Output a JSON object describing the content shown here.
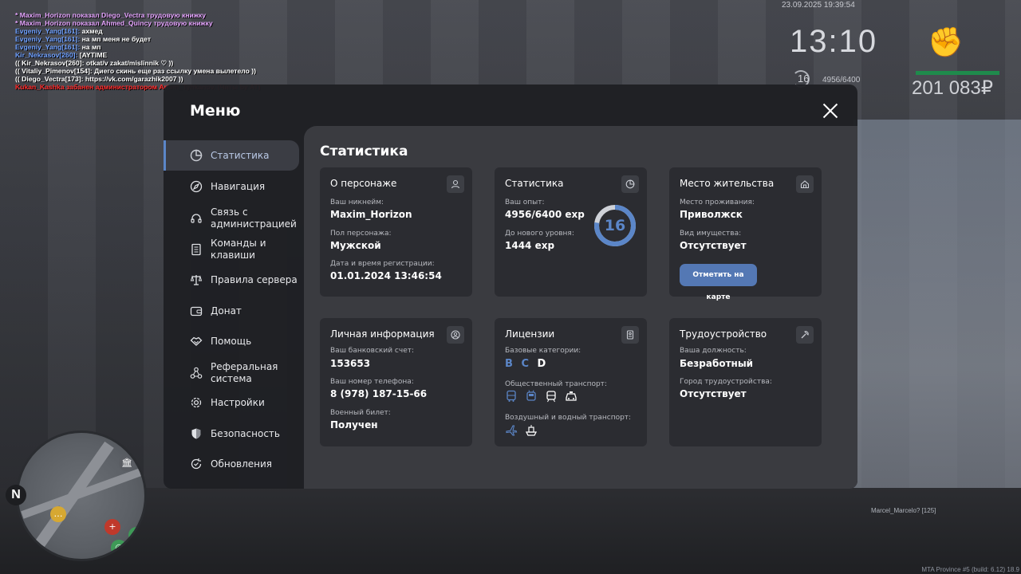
{
  "chat": [
    {
      "color": "pink",
      "text": "* Maxim_Horizon показал Diego_Vectra трудовую книжку"
    },
    {
      "color": "pink",
      "text": "* Maxim_Horizon показал Ahmed_Quincy трудовую книжку"
    },
    {
      "color": "blue",
      "text": "Evgeniy_Yang[161]:",
      "rest": " ахмед"
    },
    {
      "color": "blue",
      "text": "Evgeniy_Yang[161]:",
      "rest": " на мп меня не будет"
    },
    {
      "color": "blue",
      "text": "Evgeniy_Yang[161]:",
      "rest": " на мп"
    },
    {
      "color": "blue",
      "text": "Kir_Nekrasov[260]:",
      "rest": " [AYTIME"
    },
    {
      "color": "white",
      "text": "(( Kir_Nekrasov[260]: otkat/v zakat/mislinnik ♡ ))"
    },
    {
      "color": "white",
      "text": "(( Vitaliy_Pimenov[154]: Диего скинь еще раз ссылку умена вылетело ))"
    },
    {
      "color": "white",
      "text": "(( Diego_Vectra[173]: https://vk.com/garazhik2007 ))"
    },
    {
      "color": "red",
      "text": "Kukan_Kashka забанен администратором Artem_Tyhkanov. (Читы by AT)"
    }
  ],
  "hud": {
    "datetime": "23.09.2025 19:39:54",
    "clock": "13:10",
    "level": "16",
    "exp": "4956/6400",
    "money": "201 083₽",
    "compass": "N",
    "player_tag": "Marcel_Marcelo? [125]",
    "build": "MTA Province #5 (build: 6.12) 18.9"
  },
  "menu": {
    "title": "Меню",
    "sidebar": [
      {
        "label": "Статистика",
        "icon": "pie-chart-icon",
        "active": true
      },
      {
        "label": "Навигация",
        "icon": "compass-icon"
      },
      {
        "label": "Связь с администрацией",
        "icon": "headset-icon"
      },
      {
        "label": "Команды и клавиши",
        "icon": "document-icon"
      },
      {
        "label": "Правила сервера",
        "icon": "scales-icon"
      },
      {
        "label": "Донат",
        "icon": "wallet-icon"
      },
      {
        "label": "Помощь",
        "icon": "handshake-icon"
      },
      {
        "label": "Реферальная система",
        "icon": "network-icon"
      },
      {
        "label": "Настройки",
        "icon": "gear-icon"
      },
      {
        "label": "Безопасность",
        "icon": "shield-icon"
      },
      {
        "label": "Обновления",
        "icon": "update-icon"
      }
    ],
    "content_title": "Статистика",
    "cards": {
      "character": {
        "title": "О персонаже",
        "nickname_label": "Ваш никнейм:",
        "nickname": "Maxim_Horizon",
        "gender_label": "Пол персонажа:",
        "gender": "Мужской",
        "reg_label": "Дата и время регистрации:",
        "reg": "01.01.2024 13:46:54"
      },
      "stats": {
        "title": "Статистика",
        "exp_label": "Ваш опыт:",
        "exp": "4956/6400 exp",
        "next_label": "До нового уровня:",
        "next": "1444 exp",
        "level": "16",
        "progress": 0.774
      },
      "residence": {
        "title": "Место жительства",
        "place_label": "Место проживания:",
        "place": "Приволжск",
        "property_label": "Вид имущества:",
        "property": "Отсутствует",
        "map_button": "Отметить на карте"
      },
      "personal": {
        "title": "Личная информация",
        "bank_label": "Ваш банковский счет:",
        "bank": "153653",
        "phone_label": "Ваш номер телефона:",
        "phone": "8 (978) 187-15-66",
        "military_label": "Военный билет:",
        "military": "Получен"
      },
      "licenses": {
        "title": "Лицензии",
        "base_label": "Базовые категории:",
        "categories": [
          "B",
          "C",
          "D"
        ],
        "public_label": "Общественный транспорт:",
        "air_water_label": "Воздушный и водный транспорт:"
      },
      "employment": {
        "title": "Трудоустройство",
        "position_label": "Ваша должность:",
        "position": "Безработный",
        "city_label": "Город трудоустройства:",
        "city": "Отсутствует"
      }
    }
  },
  "colors": {
    "accent": "#5b86c8",
    "button": "#5478b4",
    "panel": "#1f2024",
    "content": "#3a3b40",
    "card": "#2b2c31"
  }
}
